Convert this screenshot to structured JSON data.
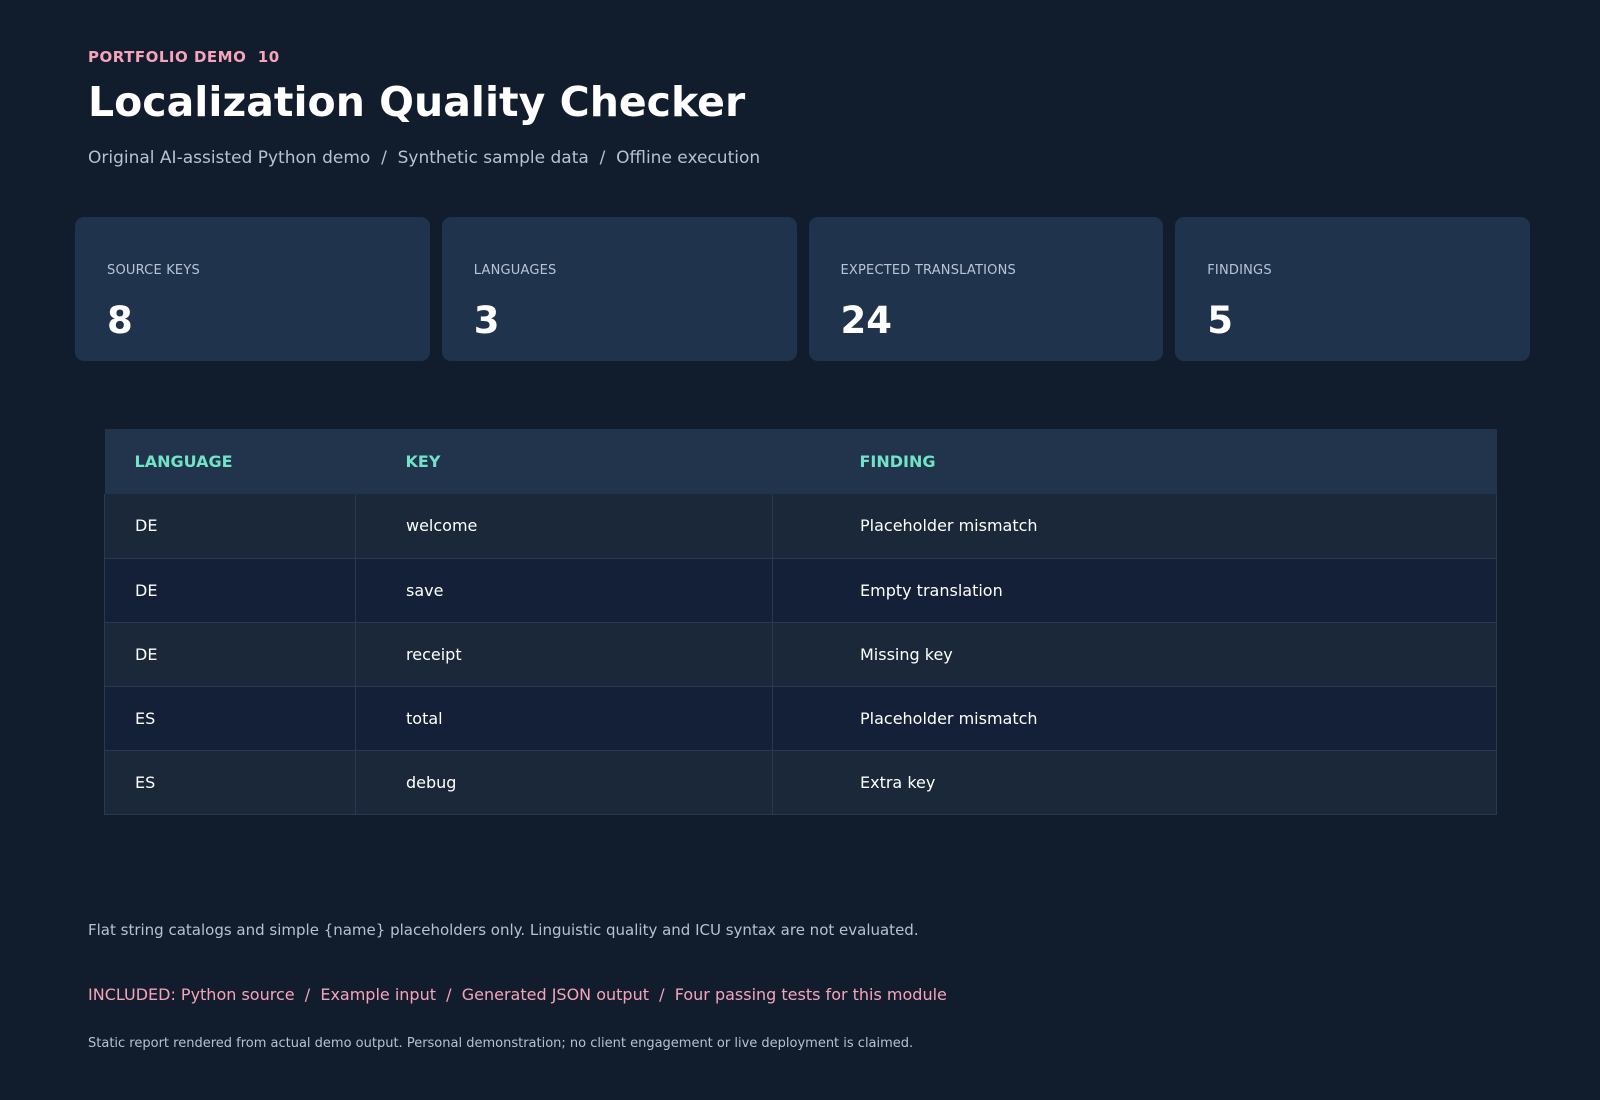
{
  "header": {
    "eyebrow": "PORTFOLIO DEMO  10",
    "title": "Localization Quality Checker",
    "subtitle": "Original AI-assisted Python demo  /  Synthetic sample data  /  Offline execution"
  },
  "stats": [
    {
      "label": "SOURCE KEYS",
      "value": "8"
    },
    {
      "label": "LANGUAGES",
      "value": "3"
    },
    {
      "label": "EXPECTED TRANSLATIONS",
      "value": "24"
    },
    {
      "label": "FINDINGS",
      "value": "5"
    }
  ],
  "table": {
    "columns": [
      "LANGUAGE",
      "KEY",
      "FINDING"
    ],
    "rows": [
      [
        "DE",
        "welcome",
        "Placeholder mismatch"
      ],
      [
        "DE",
        "save",
        "Empty translation"
      ],
      [
        "DE",
        "receipt",
        "Missing key"
      ],
      [
        "ES",
        "total",
        "Placeholder mismatch"
      ],
      [
        "ES",
        "debug",
        "Extra key"
      ]
    ]
  },
  "footer": {
    "note": "Flat string catalogs and simple {name} placeholders only. Linguistic quality and ICU syntax are not evaluated.",
    "included": "INCLUDED: Python source  /  Example input  /  Generated JSON output  /  Four passing tests for this module",
    "disclaimer": "Static report rendered from actual demo output. Personal demonstration; no client engagement or live deployment is claimed."
  }
}
